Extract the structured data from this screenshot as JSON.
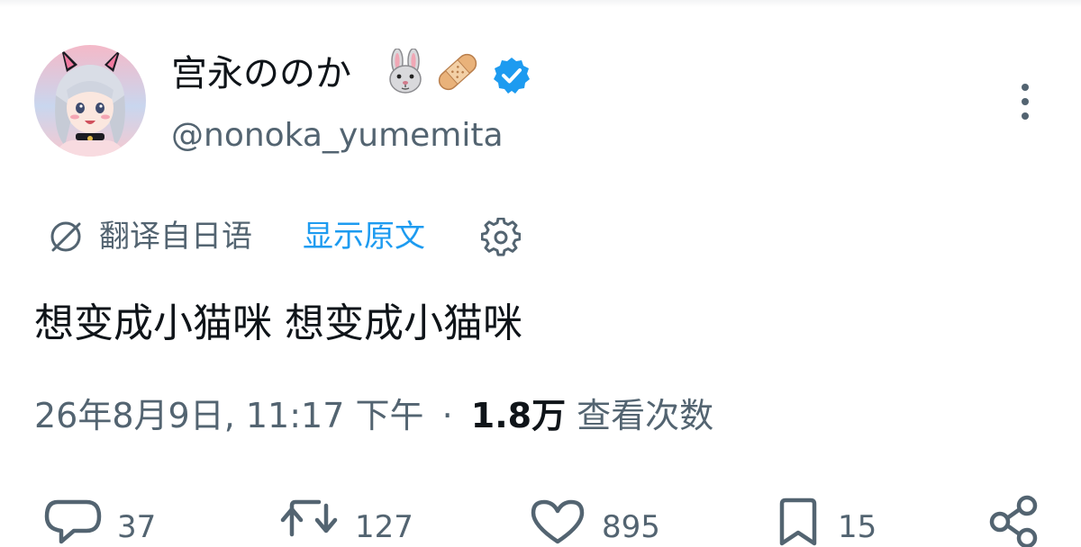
{
  "user": {
    "display_name": "宫永ののか",
    "name_emoji": [
      "rabbit-face-emoji",
      "adhesive-bandage-emoji"
    ],
    "verified": true,
    "handle": "@nonoka_yumemita"
  },
  "translation": {
    "label": "翻译自日语",
    "show_original": "显示原文"
  },
  "tweet": {
    "text": "想变成小猫咪 想变成小猫咪",
    "date": "26年8月9日, 11:17 下午",
    "separator": "·",
    "views_count": "1.8万",
    "views_label": "查看次数"
  },
  "actions": {
    "reply_count": "37",
    "retweet_count": "127",
    "like_count": "895",
    "bookmark_count": "15"
  },
  "colors": {
    "link": "#1d9bf0",
    "secondary_text": "#536471",
    "primary_text": "#0f1419",
    "verified_badge": "#1d9bf0"
  }
}
